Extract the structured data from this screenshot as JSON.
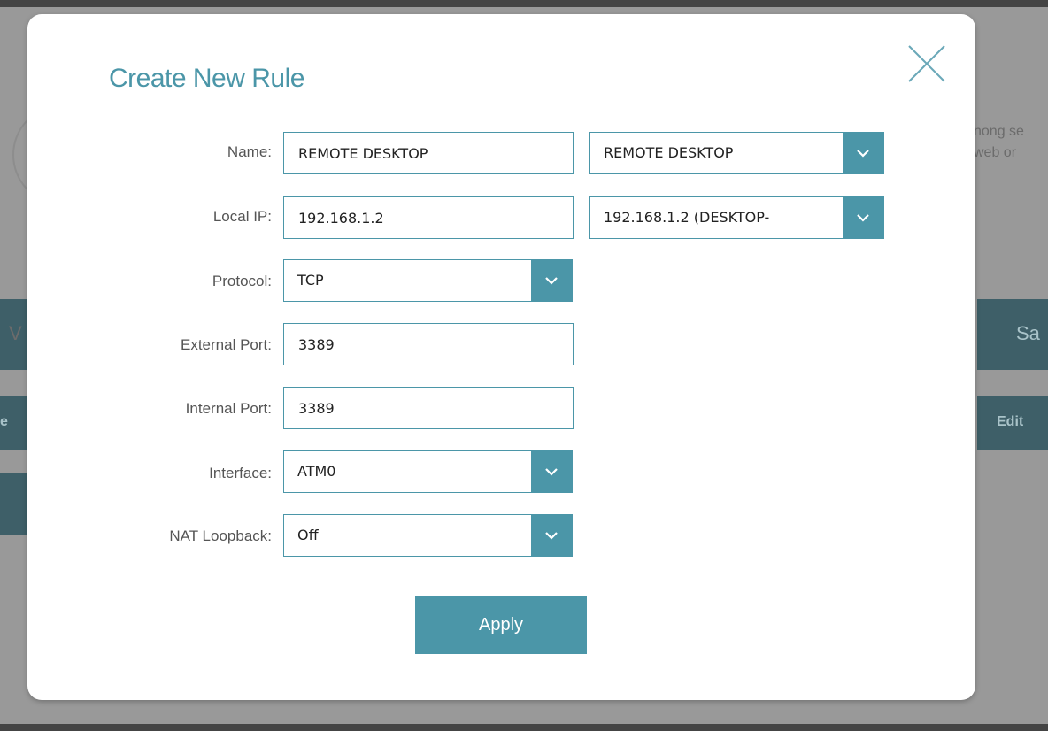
{
  "background": {
    "right_text_line1": "nong se",
    "right_text_line2": "web or",
    "left_band_text": "V",
    "right_band_text": "Sa",
    "left_header_text": "e",
    "edit_label": "Edit"
  },
  "modal": {
    "title": "Create New Rule",
    "close_icon": "close-icon",
    "fields": {
      "name": {
        "label": "Name:",
        "value": "REMOTE DESKTOP",
        "select_value": "REMOTE DESKTOP"
      },
      "local_ip": {
        "label": "Local IP:",
        "value": "192.168.1.2",
        "select_value": "192.168.1.2 (DESKTOP-"
      },
      "protocol": {
        "label": "Protocol:",
        "select_value": "TCP"
      },
      "external_port": {
        "label": "External Port:",
        "value": "3389"
      },
      "internal_port": {
        "label": "Internal Port:",
        "value": "3389"
      },
      "interface": {
        "label": "Interface:",
        "select_value": "ATM0"
      },
      "nat_loopback": {
        "label": "NAT Loopback:",
        "select_value": "Off"
      }
    },
    "apply_label": "Apply"
  },
  "colors": {
    "accent": "#4b96a8",
    "overlay": "#999999",
    "dark_band": "#3e5f68"
  }
}
